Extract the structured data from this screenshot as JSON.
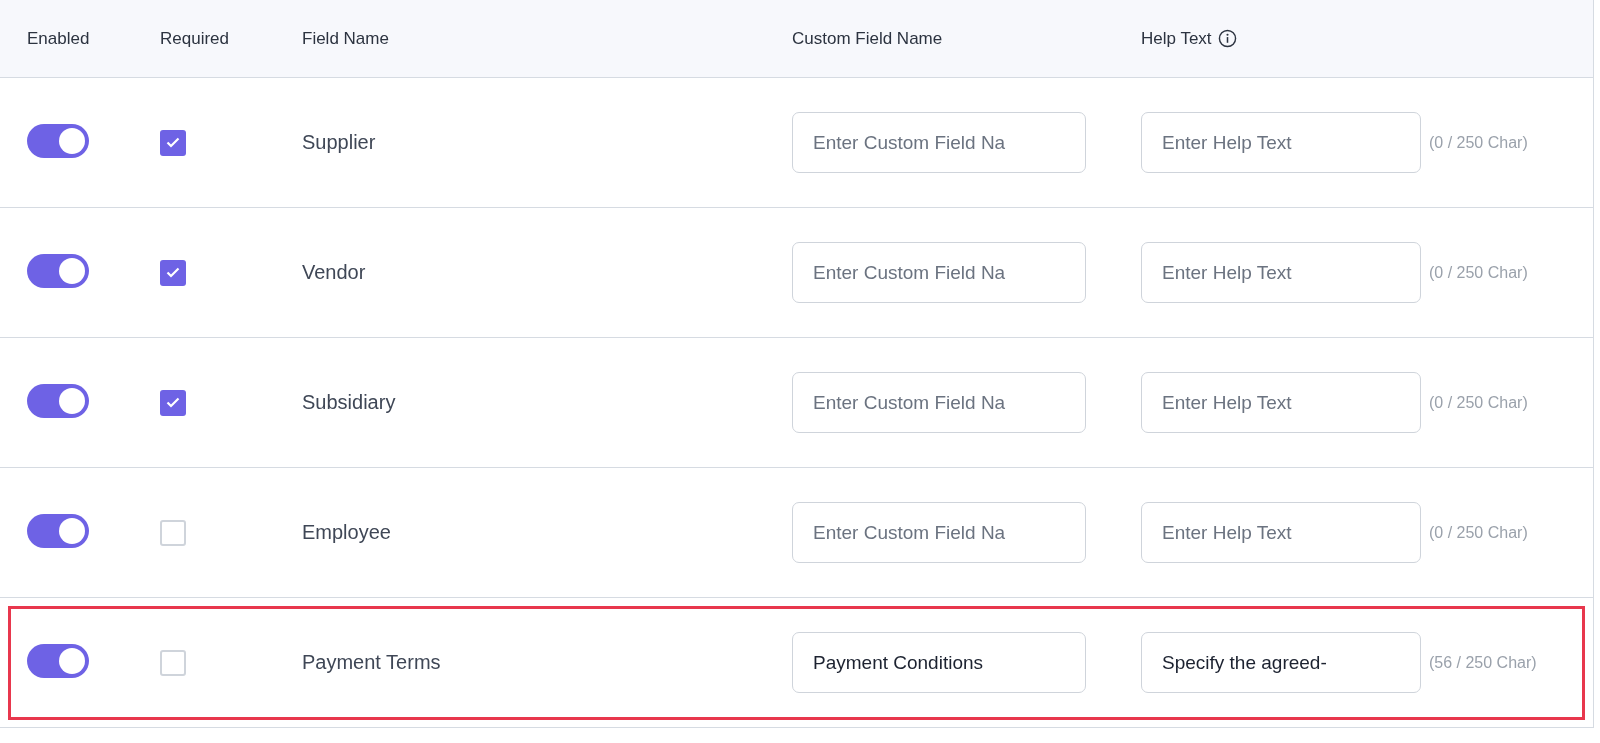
{
  "table": {
    "columns": [
      {
        "label": "Enabled"
      },
      {
        "label": "Required"
      },
      {
        "label": "Field Name"
      },
      {
        "label": "Custom Field Name"
      },
      {
        "label": "Help Text",
        "info_icon": true
      }
    ],
    "rows": [
      {
        "enabled": true,
        "required": true,
        "field_name": "Supplier",
        "custom_field_name": {
          "placeholder": "Enter Custom Field Na"
        },
        "help_text": {
          "placeholder": "Enter Help Text"
        },
        "char_count": "(0 / 250 Char)",
        "highlighted": false
      },
      {
        "enabled": true,
        "required": true,
        "field_name": "Vendor",
        "custom_field_name": {
          "placeholder": "Enter Custom Field Na"
        },
        "help_text": {
          "placeholder": "Enter Help Text"
        },
        "char_count": "(0 / 250 Char)",
        "highlighted": false
      },
      {
        "enabled": true,
        "required": true,
        "field_name": "Subsidiary",
        "custom_field_name": {
          "placeholder": "Enter Custom Field Na"
        },
        "help_text": {
          "placeholder": "Enter Help Text"
        },
        "char_count": "(0 / 250 Char)",
        "highlighted": false
      },
      {
        "enabled": true,
        "required": false,
        "field_name": "Employee",
        "custom_field_name": {
          "placeholder": "Enter Custom Field Na"
        },
        "help_text": {
          "placeholder": "Enter Help Text"
        },
        "char_count": "(0 / 250 Char)",
        "highlighted": false
      },
      {
        "enabled": true,
        "required": false,
        "field_name": "Payment Terms",
        "custom_field_name": {
          "value": "Payment Conditions"
        },
        "help_text": {
          "value": "Specify the agreed-"
        },
        "char_count": "(56 / 250 Char)",
        "highlighted": true
      }
    ]
  }
}
